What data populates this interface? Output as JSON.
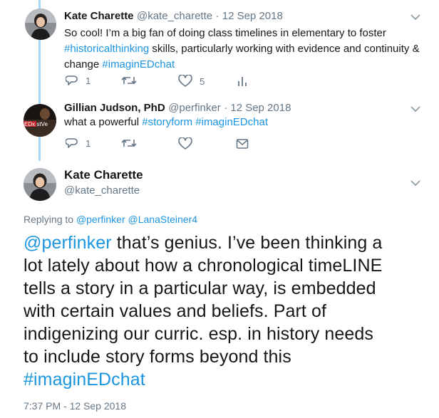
{
  "tweets": [
    {
      "display_name": "Kate Charette",
      "handle": "@kate_charette",
      "date": "· 12 Sep 2018",
      "text_before": "So cool! I’m a big fan of doing class timelines in elementary to foster ",
      "hashtag1": "#historicalthinking",
      "text_mid": " skills, particularly working with evidence and continuity & change ",
      "hashtag2": "#imaginEDchat",
      "reply_count": "1",
      "like_count": "5"
    },
    {
      "display_name": "Gillian Judson, PhD",
      "handle": "@perfinker",
      "date": "· 12 Sep 2018",
      "text_before": "what a powerful ",
      "hashtag1": "#storyform",
      "hashtag2": "#imaginEDchat",
      "reply_count": "1",
      "avatar_text": "EDx stVe"
    }
  ],
  "main_tweet": {
    "display_name": "Kate Charette",
    "handle": "@kate_charette",
    "replying_label": "Replying to ",
    "replying_to_1": "@perfinker",
    "replying_to_2": "@LanaSteiner4",
    "mention": "@perfinker",
    "line1_rest": " that’s genius. I’ve been thinking a",
    "line2": "lot lately about how a chronological timeLINE",
    "line3": "tells a story in a particular way, is embedded",
    "line4": "with certain values and beliefs. Part of",
    "line5": "indigenizing our curric. esp. in history needs",
    "line6": "to include story forms beyond this",
    "hashtag": "#imaginEDchat",
    "timestamp": "7:37 PM - 12 Sep 2018"
  },
  "colors": {
    "accent": "#1b95e0",
    "thread": "#a7d6f7",
    "muted": "#657786"
  },
  "icons": [
    "reply-icon",
    "retweet-icon",
    "like-icon",
    "analytics-icon",
    "dm-icon",
    "chevron-down-icon"
  ]
}
